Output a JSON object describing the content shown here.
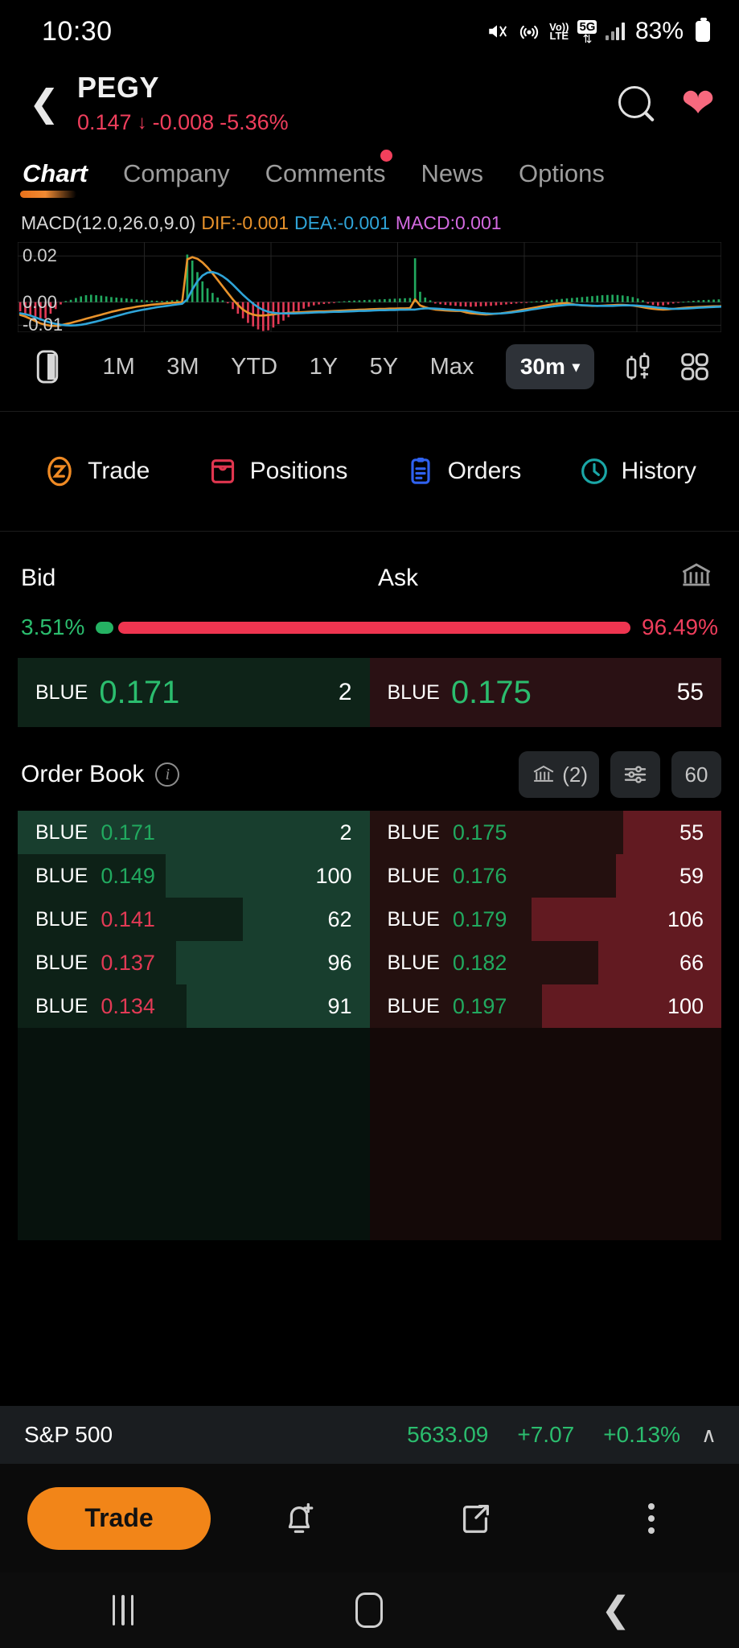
{
  "status_bar": {
    "time": "10:30",
    "battery_percent": "83%",
    "network_label_top": "Vo))",
    "network_label_bottom": "LTE",
    "five_g": "5G",
    "icons": [
      "mute-icon",
      "hotspot-icon",
      "volte-icon",
      "5g-icon",
      "signal-icon",
      "battery-icon"
    ]
  },
  "header": {
    "back_icon": "back-chevron-icon",
    "symbol": "PEGY",
    "price": "0.147",
    "change_arrow": "↓",
    "change_abs": "-0.008",
    "change_pct": "-5.36%",
    "change_color": "#ef3e5c",
    "search_icon": "search-icon",
    "favorite_icon": "heart-icon"
  },
  "tabs": [
    {
      "label": "Chart",
      "active": true,
      "badge": false
    },
    {
      "label": "Company",
      "active": false,
      "badge": false
    },
    {
      "label": "Comments",
      "active": false,
      "badge": true
    },
    {
      "label": "News",
      "active": false,
      "badge": false
    },
    {
      "label": "Options",
      "active": false,
      "badge": false
    }
  ],
  "macd": {
    "title": "MACD(12.0,26.0,9.0)",
    "dif_label": "DIF:-0.001",
    "dea_label": "DEA:-0.001",
    "macd_label": "MACD:0.001",
    "dif_color": "#e8922b",
    "dea_color": "#2fa4d8",
    "macd_color": "#d36ae0",
    "y_ticks": [
      "0.02",
      "0.00",
      "-0.01"
    ]
  },
  "chart_data": {
    "type": "bar",
    "title": "MACD(12.0,26.0,9.0)",
    "xlabel": "",
    "ylabel": "",
    "ylim": [
      -0.013,
      0.026
    ],
    "grid": true,
    "yticks": [
      0.02,
      0.0,
      -0.01
    ],
    "histogram": [
      -0.004,
      -0.005,
      -0.006,
      -0.007,
      -0.008,
      -0.007,
      -0.005,
      -0.003,
      -0.001,
      0.0005,
      0.001,
      0.0018,
      0.0025,
      0.003,
      0.0032,
      0.003,
      0.0028,
      0.0025,
      0.0022,
      0.002,
      0.0018,
      0.0016,
      0.0014,
      0.0012,
      0.001,
      0.0008,
      0.0007,
      0.0006,
      0.0005,
      0.0006,
      0.0008,
      0.001,
      0.0012,
      0.0206,
      0.018,
      0.013,
      0.009,
      0.006,
      0.004,
      0.002,
      0.0008,
      -0.0005,
      -0.003,
      -0.005,
      -0.007,
      -0.009,
      -0.0105,
      -0.0118,
      -0.0125,
      -0.0122,
      -0.011,
      -0.0095,
      -0.008,
      -0.0065,
      -0.005,
      -0.0038,
      -0.0028,
      -0.002,
      -0.0014,
      -0.001,
      -0.0008,
      -0.0006,
      -0.0004,
      0.0002,
      0.0004,
      0.0006,
      0.0007,
      0.0008,
      0.0009,
      0.001,
      0.0011,
      0.0012,
      0.0013,
      0.0014,
      0.0015,
      0.0016,
      0.0017,
      0.0018,
      0.019,
      0.0045,
      0.002,
      0.0008,
      -0.0006,
      -0.0009,
      -0.0012,
      -0.0014,
      -0.0016,
      -0.0018,
      -0.0019,
      -0.002,
      -0.0019,
      -0.0018,
      -0.0017,
      -0.0016,
      -0.0014,
      -0.0012,
      -0.001,
      -0.0008,
      -0.0006,
      -0.0004,
      -0.0002,
      0.0002,
      0.0004,
      0.0006,
      0.0008,
      0.001,
      0.0012,
      0.0014,
      0.0016,
      0.0018,
      0.002,
      0.0022,
      0.0024,
      0.0026,
      0.0028,
      0.003,
      0.0031,
      0.0032,
      0.0031,
      0.0029,
      0.0026,
      0.0022,
      0.0016,
      0.0008,
      -0.0006,
      -0.0012,
      -0.0016,
      -0.0014,
      -0.001,
      -0.0006,
      -0.0002,
      0.0002,
      0.0004,
      0.0006,
      0.0008,
      0.0009,
      0.001,
      0.0011,
      0.0012
    ],
    "series": [
      {
        "name": "DIF",
        "color": "#e8922b",
        "values": [
          -0.0055,
          -0.0062,
          -0.0072,
          -0.0082,
          -0.0092,
          -0.0098,
          -0.0102,
          -0.0103,
          -0.01,
          -0.0095,
          -0.009,
          -0.0084,
          -0.0078,
          -0.0072,
          -0.0066,
          -0.006,
          -0.0054,
          -0.0048,
          -0.0042,
          -0.0037,
          -0.0032,
          -0.0028,
          -0.0024,
          -0.002,
          -0.0017,
          -0.0014,
          -0.0011,
          -0.0009,
          -0.0007,
          -0.0005,
          -0.0003,
          -0.0001,
          0.0002,
          0.0185,
          0.0195,
          0.0188,
          0.0172,
          0.015,
          0.0124,
          0.0096,
          0.0068,
          0.004,
          0.0012,
          -0.0012,
          -0.0032,
          -0.0046,
          -0.0054,
          -0.0058,
          -0.0058,
          -0.0056,
          -0.0053,
          -0.005,
          -0.0048,
          -0.0046,
          -0.0045,
          -0.0044,
          -0.0043,
          -0.0042,
          -0.0041,
          -0.004,
          -0.004,
          -0.0039,
          -0.0038,
          -0.0037,
          -0.0036,
          -0.0035,
          -0.0034,
          -0.0033,
          -0.0032,
          -0.0031,
          -0.003,
          -0.0029,
          -0.0029,
          -0.0028,
          -0.0028,
          -0.0027,
          -0.0027,
          -0.0026,
          0.0012,
          -0.0014,
          -0.0022,
          -0.0028,
          -0.0032,
          -0.0034,
          -0.0036,
          -0.0037,
          -0.0038,
          -0.0038,
          -0.0044,
          -0.0048,
          -0.005,
          -0.0052,
          -0.0053,
          -0.0052,
          -0.005,
          -0.0048,
          -0.0045,
          -0.0042,
          -0.0038,
          -0.0034,
          -0.003,
          -0.0026,
          -0.0022,
          -0.0018,
          -0.0014,
          -0.001,
          -0.0007,
          -0.0005,
          -0.0004,
          -0.0008,
          -0.0012,
          -0.0014,
          -0.0015,
          -0.0016,
          -0.0016,
          -0.0015,
          -0.0014,
          -0.0013,
          -0.0012,
          -0.0012,
          -0.0013,
          -0.0015,
          -0.0018,
          -0.0022,
          -0.0026,
          -0.0029,
          -0.0031,
          -0.0032,
          -0.0031,
          -0.0029,
          -0.0027,
          -0.0025,
          -0.0023,
          -0.0022,
          -0.0021,
          -0.002,
          -0.0019,
          -0.0018,
          -0.0018,
          -0.0017
        ]
      },
      {
        "name": "DEA",
        "color": "#2fa4d8",
        "values": [
          -0.0048,
          -0.0052,
          -0.0058,
          -0.0066,
          -0.0074,
          -0.0082,
          -0.0089,
          -0.0094,
          -0.0098,
          -0.01,
          -0.0101,
          -0.01,
          -0.0098,
          -0.0094,
          -0.0089,
          -0.0084,
          -0.0078,
          -0.0072,
          -0.0066,
          -0.006,
          -0.0054,
          -0.0048,
          -0.0043,
          -0.0038,
          -0.0034,
          -0.003,
          -0.0026,
          -0.0022,
          -0.0019,
          -0.0016,
          -0.0013,
          -0.001,
          -0.0007,
          0.0012,
          0.0055,
          0.009,
          0.0115,
          0.0128,
          0.013,
          0.0124,
          0.0112,
          0.0096,
          0.0076,
          0.0054,
          0.0032,
          0.0012,
          -0.0006,
          -0.0022,
          -0.0034,
          -0.0042,
          -0.0046,
          -0.0048,
          -0.0049,
          -0.0049,
          -0.0049,
          -0.0048,
          -0.0047,
          -0.0046,
          -0.0045,
          -0.0044,
          -0.0044,
          -0.0043,
          -0.0042,
          -0.0042,
          -0.0041,
          -0.004,
          -0.0039,
          -0.0038,
          -0.0038,
          -0.0037,
          -0.0036,
          -0.0035,
          -0.0035,
          -0.0034,
          -0.0034,
          -0.0033,
          -0.0033,
          -0.0032,
          -0.0032,
          -0.0029,
          -0.0027,
          -0.0027,
          -0.0028,
          -0.0029,
          -0.0031,
          -0.0032,
          -0.0034,
          -0.0035,
          -0.0036,
          -0.004,
          -0.0044,
          -0.0047,
          -0.0049,
          -0.005,
          -0.005,
          -0.0049,
          -0.0047,
          -0.0045,
          -0.0042,
          -0.0039,
          -0.0036,
          -0.0032,
          -0.0029,
          -0.0025,
          -0.0022,
          -0.0019,
          -0.0016,
          -0.0014,
          -0.0012,
          -0.0011,
          -0.0012,
          -0.0013,
          -0.0014,
          -0.0015,
          -0.0016,
          -0.0016,
          -0.0016,
          -0.0016,
          -0.0015,
          -0.0014,
          -0.0014,
          -0.0014,
          -0.0015,
          -0.0017,
          -0.0019,
          -0.0021,
          -0.0024,
          -0.0026,
          -0.0028,
          -0.0029,
          -0.0029,
          -0.0028,
          -0.0027,
          -0.0026,
          -0.0024,
          -0.0023,
          -0.0022,
          -0.0021,
          -0.002,
          -0.0019,
          -0.0018
        ]
      }
    ],
    "hist_up_color": "#21a95f",
    "hist_down_color": "#e23a55"
  },
  "timeframes": {
    "candle_icon": "candle-toggle-icon",
    "ranges": [
      "1M",
      "3M",
      "YTD",
      "1Y",
      "5Y",
      "Max"
    ],
    "selected_interval": "30m",
    "caret": "▾",
    "indicator_icon": "indicator-icon",
    "layout_icon": "grid-layout-icon"
  },
  "trade_row": [
    {
      "label": "Trade",
      "icon": "trade-icon",
      "color": "#ef8a24"
    },
    {
      "label": "Positions",
      "icon": "positions-icon",
      "color": "#e0364f"
    },
    {
      "label": "Orders",
      "icon": "orders-icon",
      "color": "#2f62f0"
    },
    {
      "label": "History",
      "icon": "history-clock-icon",
      "color": "#1aa6a6"
    }
  ],
  "bid_ask": {
    "bid_label": "Bid",
    "ask_label": "Ask",
    "exchange_icon": "bank-icon",
    "bid_pct": "3.51%",
    "ask_pct": "96.49%",
    "bid_pct_value": 3.51,
    "ask_pct_value": 96.49,
    "bid_color": "#2bbd6e",
    "ask_color": "#ef3e5c",
    "top_bid": {
      "venue": "BLUE",
      "price": "0.171",
      "size": "2"
    },
    "top_ask": {
      "venue": "BLUE",
      "price": "0.175",
      "size": "55"
    }
  },
  "order_book": {
    "title": "Order Book",
    "info_icon": "info-icon",
    "exchange_btn": "(2)",
    "exchange_btn_icon": "bank-icon",
    "settings_icon": "sliders-icon",
    "depth_btn": "60",
    "bids": [
      {
        "venue": "BLUE",
        "price": "0.171",
        "size": "2",
        "dir": "up",
        "depth_pct": 100
      },
      {
        "venue": "BLUE",
        "price": "0.149",
        "size": "100",
        "dir": "up",
        "depth_pct": 58
      },
      {
        "venue": "BLUE",
        "price": "0.141",
        "size": "62",
        "dir": "dn",
        "depth_pct": 36
      },
      {
        "venue": "BLUE",
        "price": "0.137",
        "size": "96",
        "dir": "dn",
        "depth_pct": 55
      },
      {
        "venue": "BLUE",
        "price": "0.134",
        "size": "91",
        "dir": "dn",
        "depth_pct": 52
      }
    ],
    "asks": [
      {
        "venue": "BLUE",
        "price": "0.175",
        "size": "55",
        "dir": "up",
        "depth_pct": 28
      },
      {
        "venue": "BLUE",
        "price": "0.176",
        "size": "59",
        "dir": "up",
        "depth_pct": 30
      },
      {
        "venue": "BLUE",
        "price": "0.179",
        "size": "106",
        "dir": "up",
        "depth_pct": 54
      },
      {
        "venue": "BLUE",
        "price": "0.182",
        "size": "66",
        "dir": "up",
        "depth_pct": 35
      },
      {
        "venue": "BLUE",
        "price": "0.197",
        "size": "100",
        "dir": "up",
        "depth_pct": 51
      }
    ]
  },
  "index_bar": {
    "name": "S&P 500",
    "value": "5633.09",
    "change": "+7.07",
    "change_pct": "+0.13%",
    "color": "#2bbd6e",
    "caret": "∧"
  },
  "action_bar": {
    "trade_label": "Trade",
    "alert_icon": "bell-add-icon",
    "share_icon": "share-icon",
    "more_icon": "more-vertical-icon",
    "trade_color": "#f28518"
  },
  "nav_bar": {
    "recents_icon": "recents-icon",
    "home_icon": "home-icon",
    "back_icon": "back-icon"
  }
}
